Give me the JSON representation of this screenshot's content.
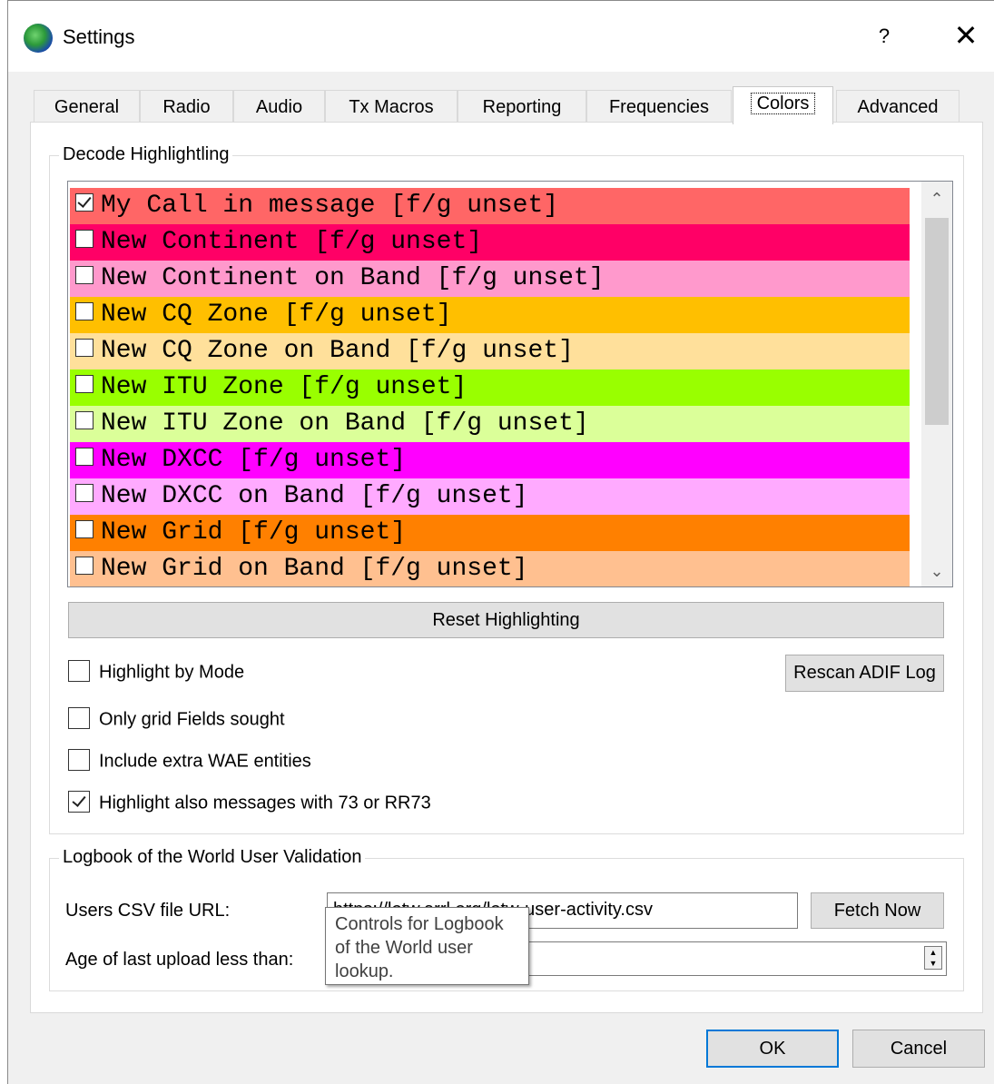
{
  "window": {
    "title": "Settings",
    "help": "?",
    "close": "✕"
  },
  "tabs": [
    "General",
    "Radio",
    "Audio",
    "Tx Macros",
    "Reporting",
    "Frequencies",
    "Colors",
    "Advanced"
  ],
  "active_tab": "Colors",
  "decode_group": {
    "title": "Decode Highlightling",
    "items": [
      {
        "label": "My Call in message [f/g unset]",
        "bg": "#ff6666",
        "fg": "#000000",
        "checked": true
      },
      {
        "label": "New Continent [f/g unset]",
        "bg": "#ff0066",
        "fg": "#000000",
        "checked": false
      },
      {
        "label": "New Continent on Band [f/g unset]",
        "bg": "#ff99cc",
        "fg": "#000000",
        "checked": false
      },
      {
        "label": "New CQ Zone [f/g unset]",
        "bg": "#ffbf00",
        "fg": "#000000",
        "checked": false
      },
      {
        "label": "New CQ Zone on Band [f/g unset]",
        "bg": "#ffe09b",
        "fg": "#000000",
        "checked": false
      },
      {
        "label": "New ITU Zone [f/g unset]",
        "bg": "#99ff00",
        "fg": "#000000",
        "checked": false
      },
      {
        "label": "New ITU Zone on Band [f/g unset]",
        "bg": "#dbff99",
        "fg": "#000000",
        "checked": false
      },
      {
        "label": "New DXCC [f/g unset]",
        "bg": "#ff00ff",
        "fg": "#000000",
        "checked": false
      },
      {
        "label": "New DXCC on Band [f/g unset]",
        "bg": "#ffaaff",
        "fg": "#000000",
        "checked": false
      },
      {
        "label": "New Grid [f/g unset]",
        "bg": "#ff8000",
        "fg": "#000000",
        "checked": false
      },
      {
        "label": "New Grid on Band [f/g unset]",
        "bg": "#ffc090",
        "fg": "#000000",
        "checked": false
      }
    ],
    "reset_button": "Reset Highlighting",
    "rescan_button": "Rescan ADIF Log",
    "options": [
      {
        "label": "Highlight by Mode",
        "checked": false
      },
      {
        "label": "Only grid Fields sought",
        "checked": false
      },
      {
        "label": "Include extra WAE entities",
        "checked": false
      },
      {
        "label": "Highlight also messages with 73 or RR73",
        "checked": true
      }
    ]
  },
  "lotw_group": {
    "title": "Logbook of the World User Validation",
    "url_label": "Users CSV file URL:",
    "url_value": "https://lotw.arrl.org/lotw-user-activity.csv",
    "fetch_button": "Fetch Now",
    "age_label": "Age of last upload less than:"
  },
  "tooltip": "Controls for Logbook of the World user lookup.",
  "buttons": {
    "ok": "OK",
    "cancel": "Cancel"
  }
}
